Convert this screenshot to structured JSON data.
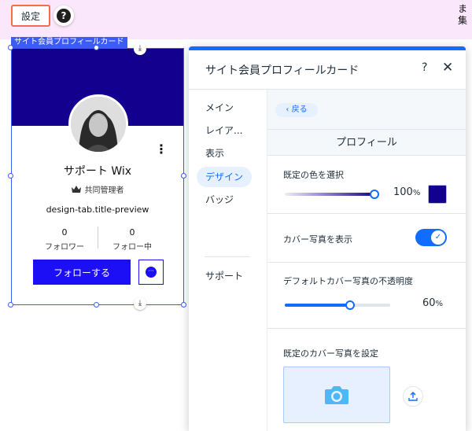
{
  "topbar": {
    "settings_label": "設定",
    "help_symbol": "?",
    "corner_text": "ま\n集"
  },
  "component": {
    "selection_label": "サイト会員プロフィールカード",
    "member_name": "サポート Wix",
    "role": "共同管理者",
    "title_preview": "design-tab.title-preview",
    "followers_count": "0",
    "followers_label": "フォロワー",
    "following_count": "0",
    "following_label": "フォロー中",
    "follow_button": "フォローする",
    "kebab": "⋮",
    "chat_dots": "···",
    "cover_color": "#13008f",
    "button_color": "#1d0ff5"
  },
  "panel": {
    "title": "サイト会員プロフィールカード",
    "help": "?",
    "close": "✕",
    "nav": [
      {
        "label": "メイン"
      },
      {
        "label": "レイア..."
      },
      {
        "label": "表示"
      },
      {
        "label": "デザイン"
      },
      {
        "label": "バッジ"
      },
      {
        "label": "サポート"
      }
    ],
    "active_nav": "デザイン",
    "back_label": "戻る",
    "section_title": "プロフィール",
    "color_section": {
      "label": "既定の色を選択",
      "opacity_value": "100",
      "unit": "%",
      "swatch_color": "#13008f"
    },
    "cover_toggle": {
      "label": "カバー写真を表示",
      "on": true
    },
    "cover_opacity": {
      "label": "デフォルトカバー写真の不透明度",
      "value": "60",
      "unit": "%"
    },
    "default_cover": {
      "label": "既定のカバー写真を設定"
    },
    "accent_color": "#116dff"
  }
}
